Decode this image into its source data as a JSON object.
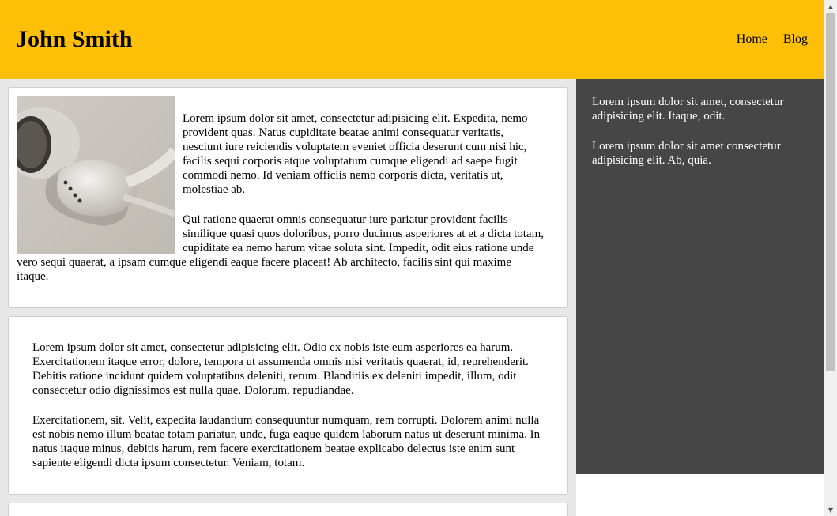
{
  "header": {
    "title": "John Smith",
    "nav": [
      {
        "label": "Home"
      },
      {
        "label": "Blog"
      }
    ]
  },
  "main": {
    "card1": {
      "image_icon": "earphones-photo",
      "paragraphs": [
        "Lorem ipsum dolor sit amet, consectetur adipisicing elit. Expedita, nemo provident quas. Natus cupiditate beatae animi consequatur veritatis, nesciunt iure reiciendis voluptatem eveniet officia deserunt cum nisi hic, facilis sequi corporis atque voluptatum cumque eligendi ad saepe fugit commodi nemo. Id veniam officiis nemo corporis dicta, veritatis ut, molestiae ab.",
        "Qui ratione quaerat omnis consequatur iure pariatur provident facilis similique quasi quos doloribus, porro ducimus asperiores at et a dicta totam, cupiditate ea nemo harum vitae soluta sint. Impedit, odit eius ratione unde vero sequi quaerat, a ipsam cumque eligendi eaque facere placeat! Ab architecto, facilis sint qui maxime itaque."
      ]
    },
    "card2": {
      "paragraphs": [
        "Lorem ipsum dolor sit amet, consectetur adipisicing elit. Odio ex nobis iste eum asperiores ea harum. Exercitationem itaque error, dolore, tempora ut assumenda omnis nisi veritatis quaerat, id, reprehenderit. Debitis ratione incidunt quidem voluptatibus deleniti, rerum. Blanditiis ex deleniti impedit, illum, odit consectetur odio dignissimos est nulla quae. Dolorum, repudiandae.",
        "Exercitationem, sit. Velit, expedita laudantium consequuntur numquam, rem corrupti. Dolorem animi nulla est nobis nemo illum beatae totam pariatur, unde, fuga eaque quidem laborum natus ut deserunt minima. In natus itaque minus, debitis harum, rem facere exercitationem beatae explicabo delectus iste enim sunt sapiente eligendi dicta ipsum consectetur. Veniam, totam."
      ]
    }
  },
  "sidebar": {
    "paragraphs": [
      "Lorem ipsum dolor sit amet, consectetur adipisicing elit. Itaque, odit.",
      "Lorem ipsum dolor sit amet consectetur adipisicing elit. Ab, quia."
    ]
  },
  "colors": {
    "header_bg": "#fec006",
    "sidebar_bg": "#464646",
    "main_bg": "#e8e8e8"
  },
  "scrollbar": {
    "up_icon": "scroll-up-arrow-icon",
    "down_icon": "scroll-down-arrow-icon"
  }
}
